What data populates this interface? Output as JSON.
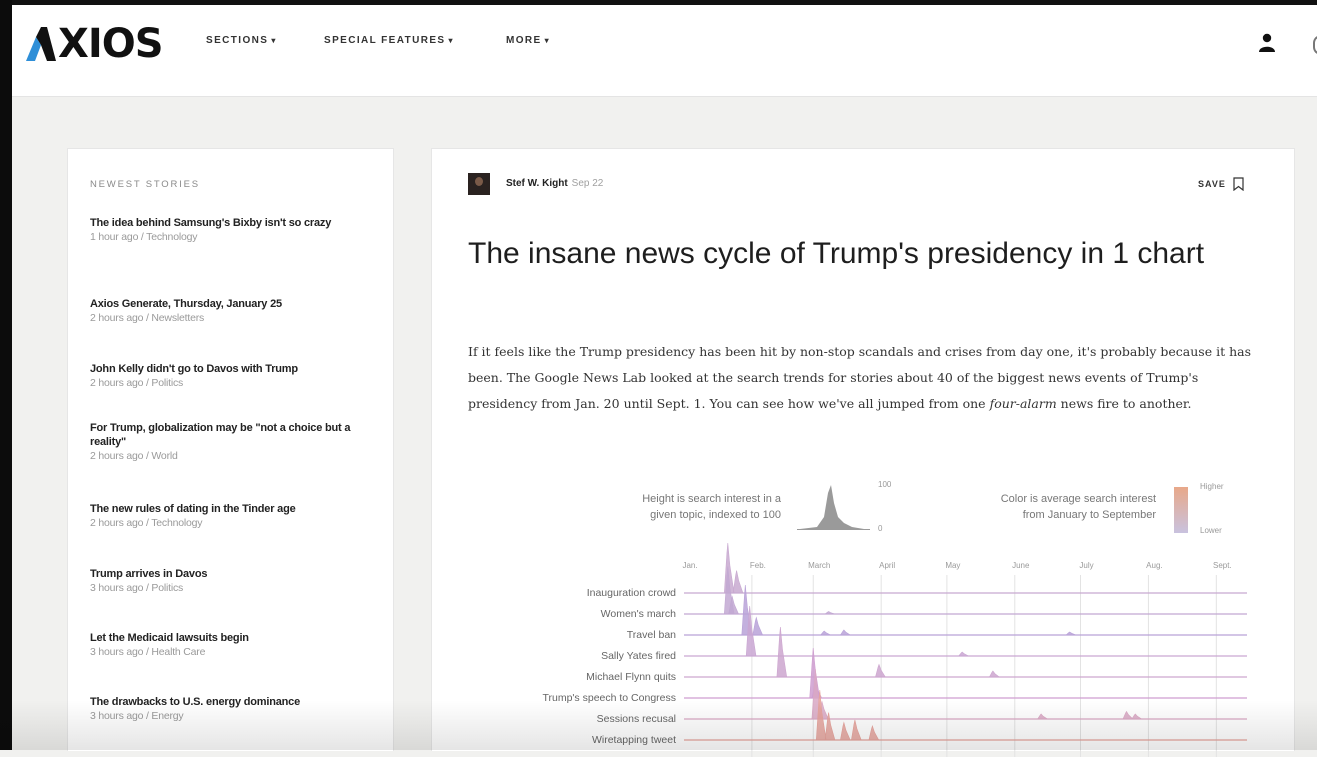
{
  "header": {
    "logo": "AXIOS",
    "nav": [
      "SECTIONS",
      "SPECIAL FEATURES",
      "MORE"
    ],
    "icons": [
      "user-icon"
    ]
  },
  "sidebar": {
    "heading": "NEWEST STORIES",
    "stories": [
      {
        "title": "The idea behind Samsung's Bixby isn't so crazy",
        "meta": "1 hour ago / Technology"
      },
      {
        "title": "Axios Generate, Thursday, January 25",
        "meta": "2 hours ago / Newsletters"
      },
      {
        "title": "John Kelly didn't go to Davos with Trump",
        "meta": "2 hours ago / Politics"
      },
      {
        "title": "For Trump, globalization may be \"not a choice but a reality\"",
        "meta": "2 hours ago / World"
      },
      {
        "title": "The new rules of dating in the Tinder age",
        "meta": "2 hours ago / Technology"
      },
      {
        "title": "Trump arrives in Davos",
        "meta": "3 hours ago / Politics"
      },
      {
        "title": "Let the Medicaid lawsuits begin",
        "meta": "3 hours ago / Health Care"
      },
      {
        "title": "The drawbacks to U.S. energy dominance",
        "meta": "3 hours ago / Energy"
      }
    ]
  },
  "article": {
    "author": "Stef W. Kight",
    "date": "Sep 22",
    "save_label": "SAVE",
    "title": "The insane news cycle of Trump's presidency in 1 chart",
    "body_before": "If it feels like the Trump presidency has been hit by non-stop scandals and crises from day one, it's probably because it has been. The Google News Lab looked at the search trends for stories about 40 of the biggest news events of Trump's presidency from Jan. 20 until Sept. 1. You can see how we've all jumped from one ",
    "body_italic": "four-alarm",
    "body_after": " news fire to another."
  },
  "chart_data": {
    "type": "area",
    "legend": {
      "height_text": [
        "Height is search interest in a",
        "given topic, indexed to 100"
      ],
      "height_max": "100",
      "height_min": "0",
      "color_text": [
        "Color is average search interest",
        "from January to September"
      ],
      "color_high": "Higher",
      "color_low": "Lower",
      "colors": {
        "high": "#e8a889",
        "low": "#c9c2df"
      }
    },
    "months": [
      "Jan.",
      "Feb.",
      "March",
      "April",
      "May",
      "June",
      "July",
      "Aug.",
      "Sept."
    ],
    "xlim": [
      "2017-01-01",
      "2017-09-15"
    ],
    "series": [
      {
        "name": "Inauguration crowd",
        "color": "#c8a9d0",
        "peaks": [
          {
            "date": "2017-01-21",
            "value": 100
          },
          {
            "date": "2017-01-25",
            "value": 45
          }
        ]
      },
      {
        "name": "Women's march",
        "color": "#c2a8d2",
        "peaks": [
          {
            "date": "2017-01-21",
            "value": 95
          },
          {
            "date": "2017-01-23",
            "value": 35
          },
          {
            "date": "2017-03-08",
            "value": 5
          }
        ]
      },
      {
        "name": "Travel ban",
        "color": "#b9a2d8",
        "peaks": [
          {
            "date": "2017-01-29",
            "value": 100
          },
          {
            "date": "2017-02-03",
            "value": 35
          },
          {
            "date": "2017-03-06",
            "value": 8
          },
          {
            "date": "2017-03-15",
            "value": 10
          },
          {
            "date": "2017-06-26",
            "value": 6
          }
        ]
      },
      {
        "name": "Sally Yates fired",
        "color": "#c9a6d2",
        "peaks": [
          {
            "date": "2017-01-31",
            "value": 100
          },
          {
            "date": "2017-05-08",
            "value": 8
          }
        ]
      },
      {
        "name": "Michael Flynn quits",
        "color": "#cda6cf",
        "peaks": [
          {
            "date": "2017-02-14",
            "value": 100
          },
          {
            "date": "2017-03-31",
            "value": 25
          },
          {
            "date": "2017-05-22",
            "value": 12
          }
        ]
      },
      {
        "name": "Trump's speech to Congress",
        "color": "#cf9ed0",
        "peaks": [
          {
            "date": "2017-03-01",
            "value": 100
          },
          {
            "date": "2017-03-02",
            "value": 30
          }
        ]
      },
      {
        "name": "Sessions recusal",
        "color": "#d9a8c4",
        "peaks": [
          {
            "date": "2017-03-02",
            "value": 100
          },
          {
            "date": "2017-03-05",
            "value": 35
          },
          {
            "date": "2017-06-13",
            "value": 10
          },
          {
            "date": "2017-07-22",
            "value": 15
          },
          {
            "date": "2017-07-26",
            "value": 10
          }
        ]
      },
      {
        "name": "Wiretapping tweet",
        "color": "#e6a39c",
        "peaks": [
          {
            "date": "2017-03-04",
            "value": 100
          },
          {
            "date": "2017-03-08",
            "value": 55
          },
          {
            "date": "2017-03-15",
            "value": 35
          },
          {
            "date": "2017-03-20",
            "value": 40
          },
          {
            "date": "2017-03-28",
            "value": 28
          }
        ]
      }
    ]
  }
}
